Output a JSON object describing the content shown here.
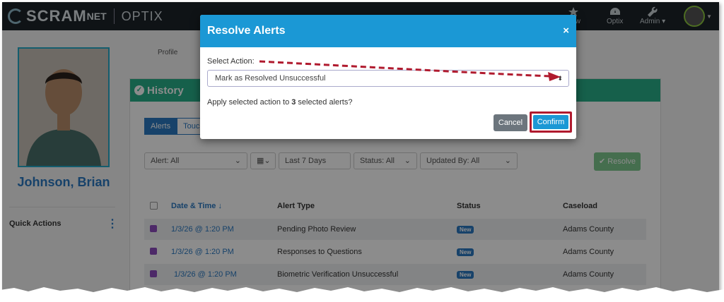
{
  "brand": {
    "logo_main": "SCRAM",
    "logo_sub": "NET",
    "logo_product": "OPTIX"
  },
  "nav": {
    "items": [
      {
        "label": "New",
        "icon": "star-icon"
      },
      {
        "label": "Optix",
        "icon": "dashboard-icon"
      },
      {
        "label": "Admin ▾",
        "icon": "wrench-icon"
      }
    ]
  },
  "profile": {
    "name": "Johnson, Brian",
    "quick_actions": "Quick Actions",
    "tab_label": "Profile"
  },
  "panel": {
    "title": "History",
    "tabs": [
      "Alerts",
      "Touch"
    ],
    "filters": {
      "alert": "Alert: All",
      "date": "Last 7 Days",
      "status": "Status: All",
      "updated_by": "Updated By: All"
    },
    "resolve_label": "Resolve"
  },
  "table": {
    "headers": [
      "Date & Time",
      "Alert Type",
      "Status",
      "Caseload"
    ],
    "rows": [
      {
        "datetime": "1/3/26 @ 1:20 PM",
        "alert_type": "Pending Photo Review",
        "status": "New",
        "caseload": "Adams County"
      },
      {
        "datetime": "1/3/26 @ 1:20 PM",
        "alert_type": "Responses to Questions",
        "status": "New",
        "caseload": "Adams County"
      },
      {
        "datetime": "1/3/26 @ 1:20 PM",
        "alert_type": "Biometric Verification Unsuccessful",
        "status": "New",
        "caseload": "Adams County"
      }
    ]
  },
  "modal": {
    "title": "Resolve Alerts",
    "close": "×",
    "select_label": "Select Action:",
    "select_value": "Mark as Resolved Unsuccessful",
    "question_pre": "Apply selected action to ",
    "question_count": "3",
    "question_post": " selected alerts?",
    "cancel": "Cancel",
    "confirm": "Confirm"
  },
  "colors": {
    "header": "#1b98d5",
    "history": "#28b089",
    "accent": "#2b79c2",
    "highlight": "#b01a2e"
  }
}
